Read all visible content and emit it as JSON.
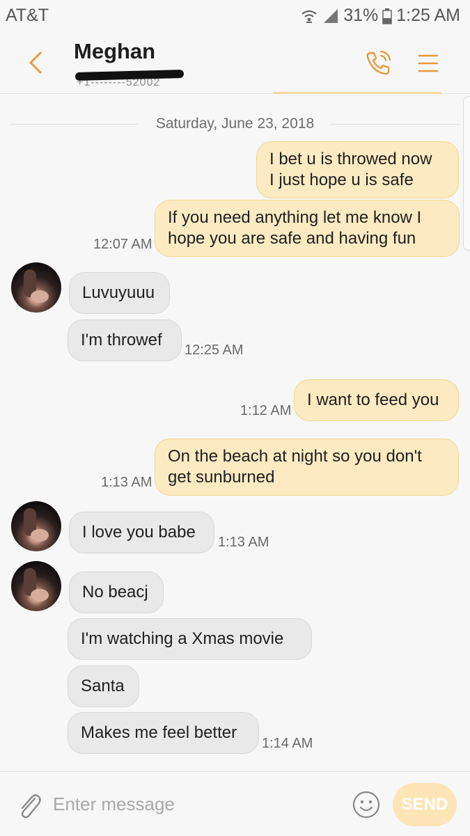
{
  "status_bar": {
    "carrier": "AT&T",
    "battery": "31%",
    "time": "1:25 AM",
    "icons": [
      "wifi-calling-icon",
      "signal-icon",
      "battery-icon"
    ]
  },
  "header": {
    "contact_name": "Meghan",
    "icons": [
      "back-arrow-icon",
      "phone-call-icon",
      "menu-icon"
    ],
    "accent_color": "#e79a3b"
  },
  "conversation": {
    "date": "Saturday, June 23, 2018",
    "messages": [
      {
        "direction": "sent",
        "text": "I bet u is throwed now\nI just hope u is safe",
        "time": ""
      },
      {
        "direction": "sent",
        "text": "If you need anything let me know I hope you are safe and having fun",
        "time": "12:07 AM"
      },
      {
        "direction": "received",
        "text": "Luvuyuuu",
        "time": ""
      },
      {
        "direction": "received",
        "text": "I'm throwef",
        "time": "12:25 AM"
      },
      {
        "direction": "sent",
        "text": "I want to feed you",
        "time": "1:12 AM"
      },
      {
        "direction": "sent",
        "text": "On the beach at night so you don't get sunburned",
        "time": "1:13 AM"
      },
      {
        "direction": "received",
        "text": "I love you babe",
        "time": "1:13 AM"
      },
      {
        "direction": "received",
        "text": "No beacj",
        "time": ""
      },
      {
        "direction": "received",
        "text": "I'm watching a Xmas movie",
        "time": ""
      },
      {
        "direction": "received",
        "text": "Santa",
        "time": ""
      },
      {
        "direction": "received",
        "text": "Makes me feel better",
        "time": "1:14 AM"
      }
    ],
    "sent_bubble_color": "#fcebc2",
    "received_bubble_color": "#e9e9e9"
  },
  "composer": {
    "placeholder": "Enter message",
    "send_label": "SEND",
    "icons": [
      "paperclip-icon",
      "emoji-icon"
    ]
  }
}
